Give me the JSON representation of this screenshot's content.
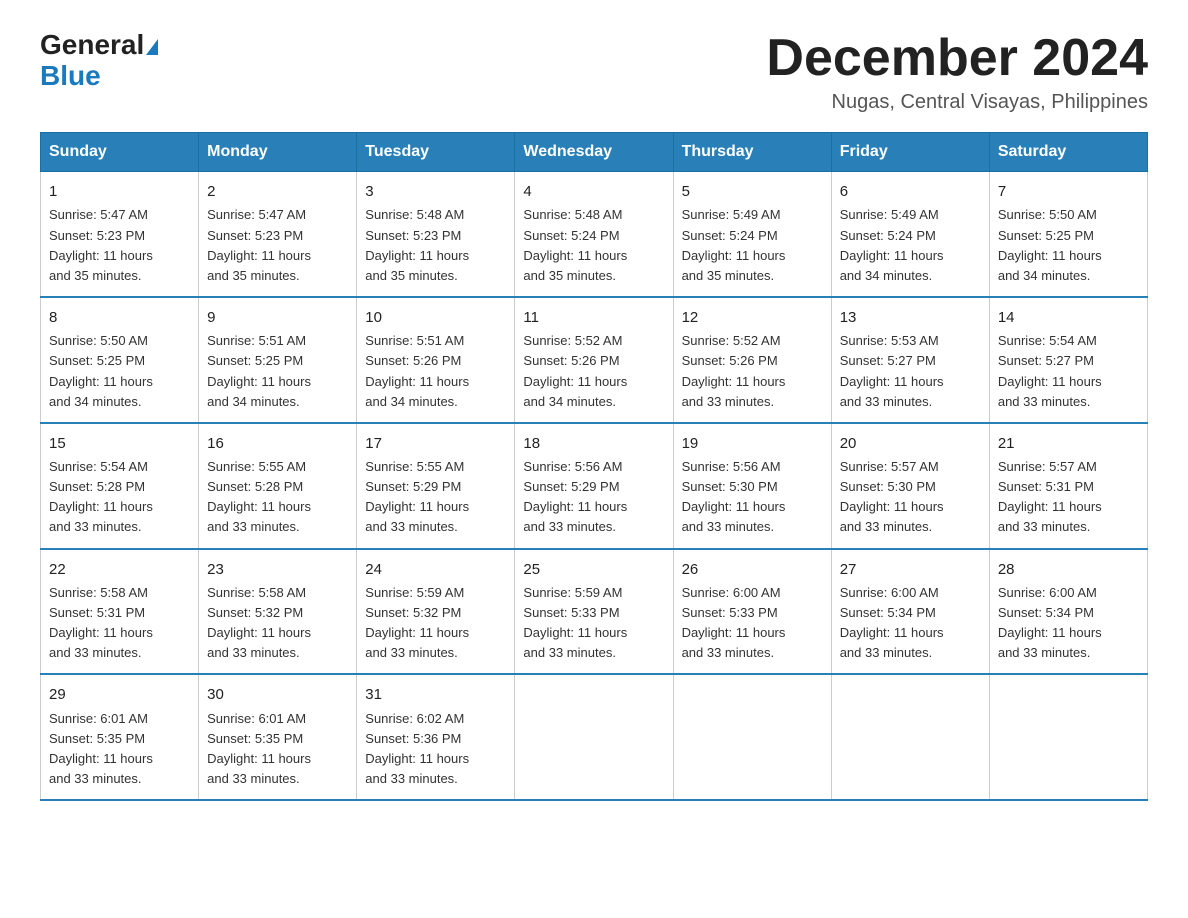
{
  "header": {
    "logo_general": "General",
    "logo_blue": "Blue",
    "month_title": "December 2024",
    "location": "Nugas, Central Visayas, Philippines"
  },
  "days_of_week": [
    "Sunday",
    "Monday",
    "Tuesday",
    "Wednesday",
    "Thursday",
    "Friday",
    "Saturday"
  ],
  "weeks": [
    [
      {
        "day": "1",
        "info": "Sunrise: 5:47 AM\nSunset: 5:23 PM\nDaylight: 11 hours\nand 35 minutes."
      },
      {
        "day": "2",
        "info": "Sunrise: 5:47 AM\nSunset: 5:23 PM\nDaylight: 11 hours\nand 35 minutes."
      },
      {
        "day": "3",
        "info": "Sunrise: 5:48 AM\nSunset: 5:23 PM\nDaylight: 11 hours\nand 35 minutes."
      },
      {
        "day": "4",
        "info": "Sunrise: 5:48 AM\nSunset: 5:24 PM\nDaylight: 11 hours\nand 35 minutes."
      },
      {
        "day": "5",
        "info": "Sunrise: 5:49 AM\nSunset: 5:24 PM\nDaylight: 11 hours\nand 35 minutes."
      },
      {
        "day": "6",
        "info": "Sunrise: 5:49 AM\nSunset: 5:24 PM\nDaylight: 11 hours\nand 34 minutes."
      },
      {
        "day": "7",
        "info": "Sunrise: 5:50 AM\nSunset: 5:25 PM\nDaylight: 11 hours\nand 34 minutes."
      }
    ],
    [
      {
        "day": "8",
        "info": "Sunrise: 5:50 AM\nSunset: 5:25 PM\nDaylight: 11 hours\nand 34 minutes."
      },
      {
        "day": "9",
        "info": "Sunrise: 5:51 AM\nSunset: 5:25 PM\nDaylight: 11 hours\nand 34 minutes."
      },
      {
        "day": "10",
        "info": "Sunrise: 5:51 AM\nSunset: 5:26 PM\nDaylight: 11 hours\nand 34 minutes."
      },
      {
        "day": "11",
        "info": "Sunrise: 5:52 AM\nSunset: 5:26 PM\nDaylight: 11 hours\nand 34 minutes."
      },
      {
        "day": "12",
        "info": "Sunrise: 5:52 AM\nSunset: 5:26 PM\nDaylight: 11 hours\nand 33 minutes."
      },
      {
        "day": "13",
        "info": "Sunrise: 5:53 AM\nSunset: 5:27 PM\nDaylight: 11 hours\nand 33 minutes."
      },
      {
        "day": "14",
        "info": "Sunrise: 5:54 AM\nSunset: 5:27 PM\nDaylight: 11 hours\nand 33 minutes."
      }
    ],
    [
      {
        "day": "15",
        "info": "Sunrise: 5:54 AM\nSunset: 5:28 PM\nDaylight: 11 hours\nand 33 minutes."
      },
      {
        "day": "16",
        "info": "Sunrise: 5:55 AM\nSunset: 5:28 PM\nDaylight: 11 hours\nand 33 minutes."
      },
      {
        "day": "17",
        "info": "Sunrise: 5:55 AM\nSunset: 5:29 PM\nDaylight: 11 hours\nand 33 minutes."
      },
      {
        "day": "18",
        "info": "Sunrise: 5:56 AM\nSunset: 5:29 PM\nDaylight: 11 hours\nand 33 minutes."
      },
      {
        "day": "19",
        "info": "Sunrise: 5:56 AM\nSunset: 5:30 PM\nDaylight: 11 hours\nand 33 minutes."
      },
      {
        "day": "20",
        "info": "Sunrise: 5:57 AM\nSunset: 5:30 PM\nDaylight: 11 hours\nand 33 minutes."
      },
      {
        "day": "21",
        "info": "Sunrise: 5:57 AM\nSunset: 5:31 PM\nDaylight: 11 hours\nand 33 minutes."
      }
    ],
    [
      {
        "day": "22",
        "info": "Sunrise: 5:58 AM\nSunset: 5:31 PM\nDaylight: 11 hours\nand 33 minutes."
      },
      {
        "day": "23",
        "info": "Sunrise: 5:58 AM\nSunset: 5:32 PM\nDaylight: 11 hours\nand 33 minutes."
      },
      {
        "day": "24",
        "info": "Sunrise: 5:59 AM\nSunset: 5:32 PM\nDaylight: 11 hours\nand 33 minutes."
      },
      {
        "day": "25",
        "info": "Sunrise: 5:59 AM\nSunset: 5:33 PM\nDaylight: 11 hours\nand 33 minutes."
      },
      {
        "day": "26",
        "info": "Sunrise: 6:00 AM\nSunset: 5:33 PM\nDaylight: 11 hours\nand 33 minutes."
      },
      {
        "day": "27",
        "info": "Sunrise: 6:00 AM\nSunset: 5:34 PM\nDaylight: 11 hours\nand 33 minutes."
      },
      {
        "day": "28",
        "info": "Sunrise: 6:00 AM\nSunset: 5:34 PM\nDaylight: 11 hours\nand 33 minutes."
      }
    ],
    [
      {
        "day": "29",
        "info": "Sunrise: 6:01 AM\nSunset: 5:35 PM\nDaylight: 11 hours\nand 33 minutes."
      },
      {
        "day": "30",
        "info": "Sunrise: 6:01 AM\nSunset: 5:35 PM\nDaylight: 11 hours\nand 33 minutes."
      },
      {
        "day": "31",
        "info": "Sunrise: 6:02 AM\nSunset: 5:36 PM\nDaylight: 11 hours\nand 33 minutes."
      },
      {
        "day": "",
        "info": ""
      },
      {
        "day": "",
        "info": ""
      },
      {
        "day": "",
        "info": ""
      },
      {
        "day": "",
        "info": ""
      }
    ]
  ]
}
